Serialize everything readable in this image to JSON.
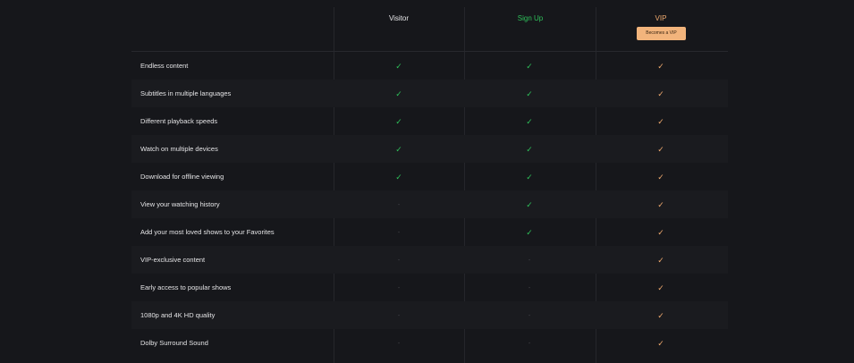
{
  "columns": {
    "visitor": "Visitor",
    "signup": "Sign Up",
    "vip": "VIP"
  },
  "vip_button_label": "Becomes a VIP",
  "icons": {
    "check": "✓",
    "dash": "-"
  },
  "colors": {
    "background": "#16171b",
    "signup_green": "#2ec15a",
    "vip_orange": "#f0aa6e",
    "vip_button": "#f2b47c"
  },
  "features": [
    {
      "label": "Endless content",
      "visitor": true,
      "signup": true,
      "vip": true
    },
    {
      "label": "Subtitles in multiple languages",
      "visitor": true,
      "signup": true,
      "vip": true
    },
    {
      "label": "Different playback speeds",
      "visitor": true,
      "signup": true,
      "vip": true
    },
    {
      "label": "Watch on multiple devices",
      "visitor": true,
      "signup": true,
      "vip": true
    },
    {
      "label": "Download for offline viewing",
      "visitor": true,
      "signup": true,
      "vip": true
    },
    {
      "label": "View your watching history",
      "visitor": false,
      "signup": true,
      "vip": true
    },
    {
      "label": "Add your most loved shows to your Favorites",
      "visitor": false,
      "signup": true,
      "vip": true
    },
    {
      "label": "VIP-exclusive content",
      "visitor": false,
      "signup": false,
      "vip": true
    },
    {
      "label": "Early access to popular shows",
      "visitor": false,
      "signup": false,
      "vip": true
    },
    {
      "label": "1080p and 4K HD quality",
      "visitor": false,
      "signup": false,
      "vip": true
    },
    {
      "label": "Dolby Surround Sound",
      "visitor": false,
      "signup": false,
      "vip": true
    }
  ]
}
